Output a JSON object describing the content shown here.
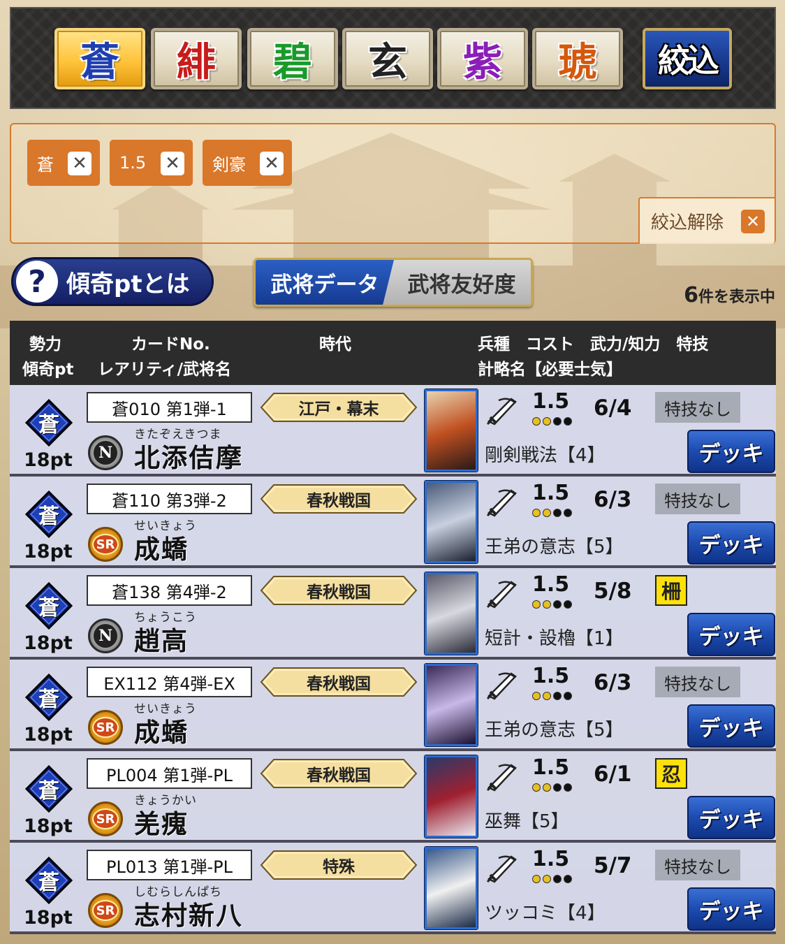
{
  "factions": [
    {
      "label": "蒼",
      "color": "#1f3fb0",
      "active": true
    },
    {
      "label": "緋",
      "color": "#c81b1b",
      "active": false
    },
    {
      "label": "碧",
      "color": "#1a9a2a",
      "active": false
    },
    {
      "label": "玄",
      "color": "#222222",
      "active": false
    },
    {
      "label": "紫",
      "color": "#8a1fb8",
      "active": false
    },
    {
      "label": "琥",
      "color": "#d4580e",
      "active": false
    }
  ],
  "filter_button": "絞込",
  "tags": [
    {
      "label": "蒼"
    },
    {
      "label": "1.5"
    },
    {
      "label": "剣豪"
    }
  ],
  "clear_all": "絞込解除",
  "clear_icon": "✕",
  "help": {
    "icon": "?",
    "label": "傾奇ptとは"
  },
  "tabs": {
    "active": "武将データ",
    "inactive": "武将友好度"
  },
  "result_count": {
    "num": "6",
    "suffix": "件を表示中"
  },
  "header": {
    "faction": "勢力",
    "kabuki": "傾奇pt",
    "cardno": "カードNo.",
    "rarity_name": "レアリティ/武将名",
    "era": "時代",
    "unit_cost_stat_skill": "兵種　コスト　武力/知力　特技",
    "strategy": "計略名【必要士気】"
  },
  "deck_label": "デッキ",
  "faction_badge": "蒼",
  "rows": [
    {
      "pt": "18pt",
      "cardno": "蒼010 第1弾-1",
      "rarity": "N",
      "rarity_label": "N",
      "furi": "きたぞえきつま",
      "name": "北添佶摩",
      "era": "江戸・幕末",
      "cost": "1.5",
      "stat": "6/4",
      "skill": "特技なし",
      "skill_type": "none",
      "strategy": "剛剣戦法【4】",
      "portrait": [
        "#e8d2b0",
        "#c05020",
        "#2a1a18"
      ]
    },
    {
      "pt": "18pt",
      "cardno": "蒼110 第3弾-2",
      "rarity": "SR",
      "rarity_label": "SR",
      "furi": "せいきょう",
      "name": "成蟜",
      "era": "春秋戦国",
      "cost": "1.5",
      "stat": "6/3",
      "skill": "特技なし",
      "skill_type": "none",
      "strategy": "王弟の意志【5】",
      "portrait": [
        "#4a5a78",
        "#c8d0e0",
        "#1a2030"
      ]
    },
    {
      "pt": "18pt",
      "cardno": "蒼138 第4弾-2",
      "rarity": "N",
      "rarity_label": "N",
      "furi": "ちょうこう",
      "name": "趙高",
      "era": "春秋戦国",
      "cost": "1.5",
      "stat": "5/8",
      "skill": "柵",
      "skill_type": "icon",
      "strategy": "短計・設櫓【1】",
      "portrait": [
        "#5a5a6a",
        "#d8d8e0",
        "#2a2a38"
      ]
    },
    {
      "pt": "18pt",
      "cardno": "EX112 第4弾-EX",
      "rarity": "SR",
      "rarity_label": "SR",
      "furi": "せいきょう",
      "name": "成蟜",
      "era": "春秋戦国",
      "cost": "1.5",
      "stat": "6/3",
      "skill": "特技なし",
      "skill_type": "none",
      "strategy": "王弟の意志【5】",
      "portrait": [
        "#3a2a5a",
        "#c8b8e8",
        "#1a1030"
      ]
    },
    {
      "pt": "18pt",
      "cardno": "PL004 第1弾-PL",
      "rarity": "SR",
      "rarity_label": "SR",
      "furi": "きょうかい",
      "name": "羌瘣",
      "era": "春秋戦国",
      "cost": "1.5",
      "stat": "6/1",
      "skill": "忍",
      "skill_type": "icon",
      "strategy": "巫舞【5】",
      "portrait": [
        "#2a3a6a",
        "#a02030",
        "#e8e8f0"
      ]
    },
    {
      "pt": "18pt",
      "cardno": "PL013 第1弾-PL",
      "rarity": "SR",
      "rarity_label": "SR",
      "furi": "しむらしんぱち",
      "name": "志村新八",
      "era": "特殊",
      "cost": "1.5",
      "stat": "5/7",
      "skill": "特技なし",
      "skill_type": "none",
      "strategy": "ツッコミ【4】",
      "portrait": [
        "#3a5a8a",
        "#f0f0f0",
        "#1a2a48"
      ]
    }
  ]
}
